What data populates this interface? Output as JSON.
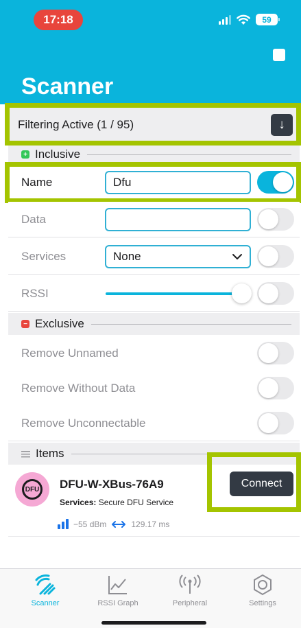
{
  "status_bar": {
    "time": "17:18",
    "battery": "59"
  },
  "header": {
    "title": "Scanner"
  },
  "filter": {
    "label": "Filtering Active (1 / 95)",
    "arrow": "↓"
  },
  "inclusive": {
    "title": "Inclusive",
    "name_row": {
      "label": "Name",
      "value": "Dfu",
      "toggle": true
    },
    "data_row": {
      "label": "Data",
      "value": "",
      "toggle": false
    },
    "services_row": {
      "label": "Services",
      "value": "None",
      "toggle": false
    },
    "rssi_row": {
      "label": "RSSI",
      "toggle": false
    }
  },
  "exclusive": {
    "title": "Exclusive",
    "remove_unnamed": {
      "label": "Remove Unnamed",
      "toggle": false
    },
    "remove_without_data": {
      "label": "Remove Without Data",
      "toggle": false
    },
    "remove_unconnectable": {
      "label": "Remove Unconnectable",
      "toggle": false
    }
  },
  "items": {
    "title": "Items",
    "device": {
      "logo_text": "DFU",
      "name": "DFU-W-XBus-76A9",
      "services_label": "Services:",
      "services_value": "Secure DFU Service",
      "rssi": "−55 dBm",
      "interval": "129.17 ms",
      "connect_label": "Connect"
    }
  },
  "tabs": [
    {
      "label": "Scanner",
      "icon": "scanner-icon",
      "active": true
    },
    {
      "label": "RSSI Graph",
      "icon": "graph-icon",
      "active": false
    },
    {
      "label": "Peripheral",
      "icon": "peripheral-icon",
      "active": false
    },
    {
      "label": "Settings",
      "icon": "settings-icon",
      "active": false
    }
  ],
  "colors": {
    "accent": "#0ab4dc",
    "highlight": "#a4c400",
    "button_dark": "#333a44",
    "dfu_pink": "#f5a8d4"
  }
}
